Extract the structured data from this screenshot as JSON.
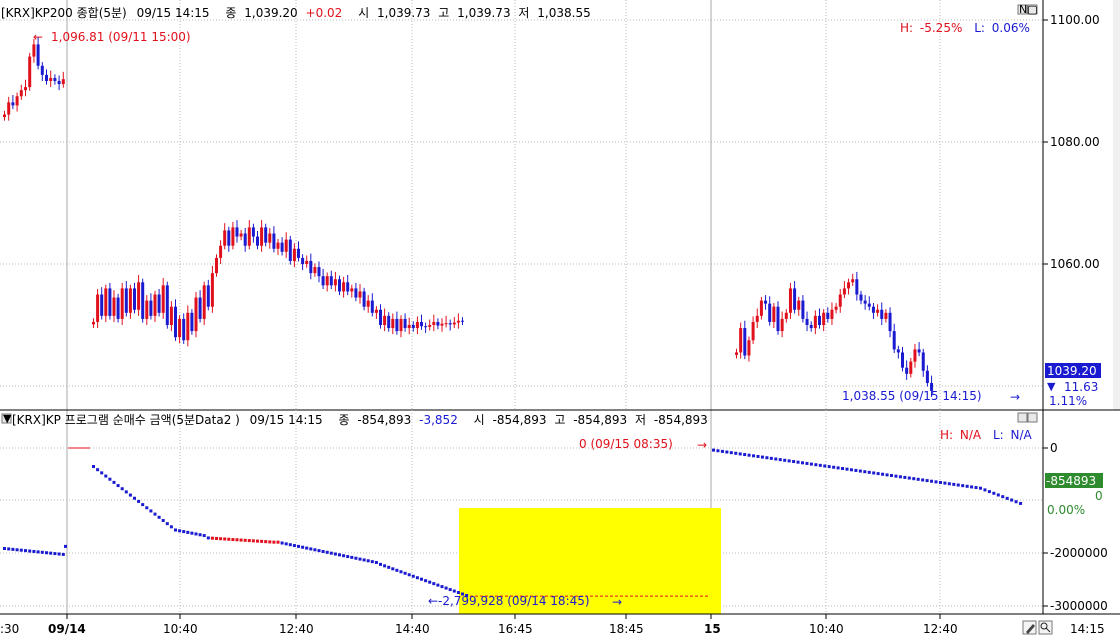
{
  "top_panel": {
    "info": {
      "symbol": "[KRX]KP200 종합(5분)",
      "datetime": "09/15 14:15",
      "close_label": "종",
      "close_value": "1,039.20",
      "change": "+0.02",
      "open_label": "시",
      "open_value": "1,039.73",
      "high_label": "고",
      "high_value": "1,039.73",
      "low_label": "저",
      "low_value": "1,038.55"
    },
    "hl": {
      "h_label": "H:",
      "h_value": "-5.25%",
      "l_label": "L:",
      "l_value": "0.06%"
    },
    "max_annotation": "1,096.81 (09/11 15:00)",
    "min_annotation": "1,038.55 (09/15 14:15)",
    "current_price": "1039.20",
    "change_value": "11.63",
    "change_pct": "1.11%",
    "y_ticks": [
      "1100.00",
      "1080.00",
      "1060.00"
    ],
    "window_buttons": "N▢"
  },
  "bottom_panel": {
    "info": {
      "symbol": "[KRX]KP 프로그램 순매수 금액(5분Data2 )",
      "datetime": "09/15 14:15",
      "close_label": "종",
      "close_value": "-854,893",
      "change": "-3,852",
      "open_label": "시",
      "open_value": "-854,893",
      "high_label": "고",
      "high_value": "-854,893",
      "low_label": "저",
      "low_value": "-854,893"
    },
    "hl": {
      "h_label": "H:",
      "h_value": "N/A",
      "l_label": "L:",
      "l_value": "N/A"
    },
    "max_annotation": "0 (09/15 08:35)",
    "min_annotation": "-2,799,928 (09/14 18:45)",
    "current_value": "-854893",
    "zero_change": "0",
    "zero_pct": "0.00%",
    "y_ticks": [
      "0",
      "-2000000",
      "-3000000"
    ]
  },
  "x_axis": {
    "labels": [
      ":30",
      "09/14",
      "10:40",
      "12:40",
      "14:40",
      "16:45",
      "18:45",
      "15",
      "10:40",
      "12:40"
    ],
    "bold_labels": [
      "09/14",
      "15"
    ],
    "right_time": "14:15"
  },
  "colors": {
    "up": "#e0101c",
    "down": "#1a1ad0",
    "highlight": "#ffff00",
    "current_bg": "#1a1ad0",
    "program_bg": "#2e8b2e",
    "grid": "#b8b8b8"
  },
  "chart_data": [
    {
      "type": "candlestick",
      "title": "[KRX]KP200 종합(5분)",
      "y_range": [
        1035,
        1103
      ],
      "yticks": [
        1060,
        1080,
        1100
      ],
      "last": 1039.2,
      "high_mark": 1096.81,
      "low_mark": 1038.55
    },
    {
      "type": "line",
      "title": "[KRX]KP 프로그램 순매수 금액(5분Data2 )",
      "y_range": [
        -3020000,
        160000
      ],
      "yticks": [
        0,
        -2000000,
        -3000000
      ],
      "last": -854893,
      "min_mark": -2799928
    }
  ]
}
